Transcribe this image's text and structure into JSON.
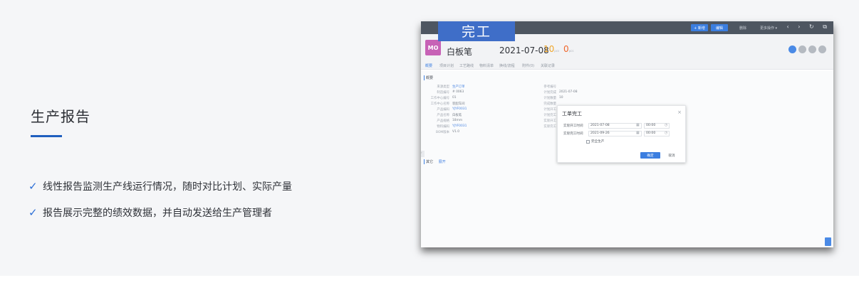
{
  "left": {
    "title": "生产报告",
    "bullets": [
      "线性报告监测生产线运行情况，随时对比计划、实际产量",
      "报告展示完整的绩效数据，并自动发送给生产管理者"
    ]
  },
  "app": {
    "done_tab": "完工",
    "toolbar": {
      "new": "+ 新增",
      "edit": "编辑",
      "delete": "删除",
      "more": "更多操作 ▾",
      "icons": "‹ › ↻ ⧉"
    },
    "header": {
      "avatar": "MO",
      "name": "白板笔",
      "date": "2021-07-08",
      "planned_qty": "10",
      "done_qty": "0",
      "unit": "pcs"
    },
    "tabs": [
      "概要",
      "项目计划",
      "工艺路线",
      "物料清单",
      "换线/流程",
      "附件(0)",
      "关联记录"
    ],
    "overview": {
      "section": "概要",
      "fields_left": [
        {
          "label": "来源类型",
          "value": "生产订单",
          "link": true
        },
        {
          "label": "制造编号",
          "value": "# 0063",
          "link": false
        },
        {
          "label": "工作中心编号",
          "value": "01",
          "link": false
        },
        {
          "label": "工作中心名称",
          "value": "装配车间",
          "link": false
        },
        {
          "label": "产品编码",
          "value": "YJYF0031",
          "link": true
        },
        {
          "label": "产品名称",
          "value": "白板笔",
          "link": false
        },
        {
          "label": "产品规格",
          "value": "18mm",
          "link": false
        },
        {
          "label": "物料编码",
          "value": "YJYF0031",
          "link": true
        },
        {
          "label": "BOM版本",
          "value": "V1.0",
          "link": false
        }
      ],
      "fields_right": [
        {
          "label": "参考编号",
          "value": ""
        },
        {
          "label": "计划完成",
          "value": "2021-07-08"
        },
        {
          "label": "计划数量",
          "value": "10"
        },
        {
          "label": "完成数量",
          "value": ""
        },
        {
          "label": "计划开工",
          "value": ""
        },
        {
          "label": "计划完工",
          "value": ""
        },
        {
          "label": "实际开工",
          "value": ""
        },
        {
          "label": "实际完工",
          "value": ""
        }
      ],
      "section2": "其它",
      "section2_link": "展开"
    },
    "dialog": {
      "title": "工单完工",
      "close": "×",
      "start_label": "实际开工时间",
      "start_date": "2021-07-08",
      "start_time": "00:00",
      "end_label": "实际完工时间",
      "end_date": "2021-09-26",
      "end_time": "00:00",
      "checkbox": "完全生产",
      "ok": "确定",
      "cancel": "取消"
    }
  }
}
